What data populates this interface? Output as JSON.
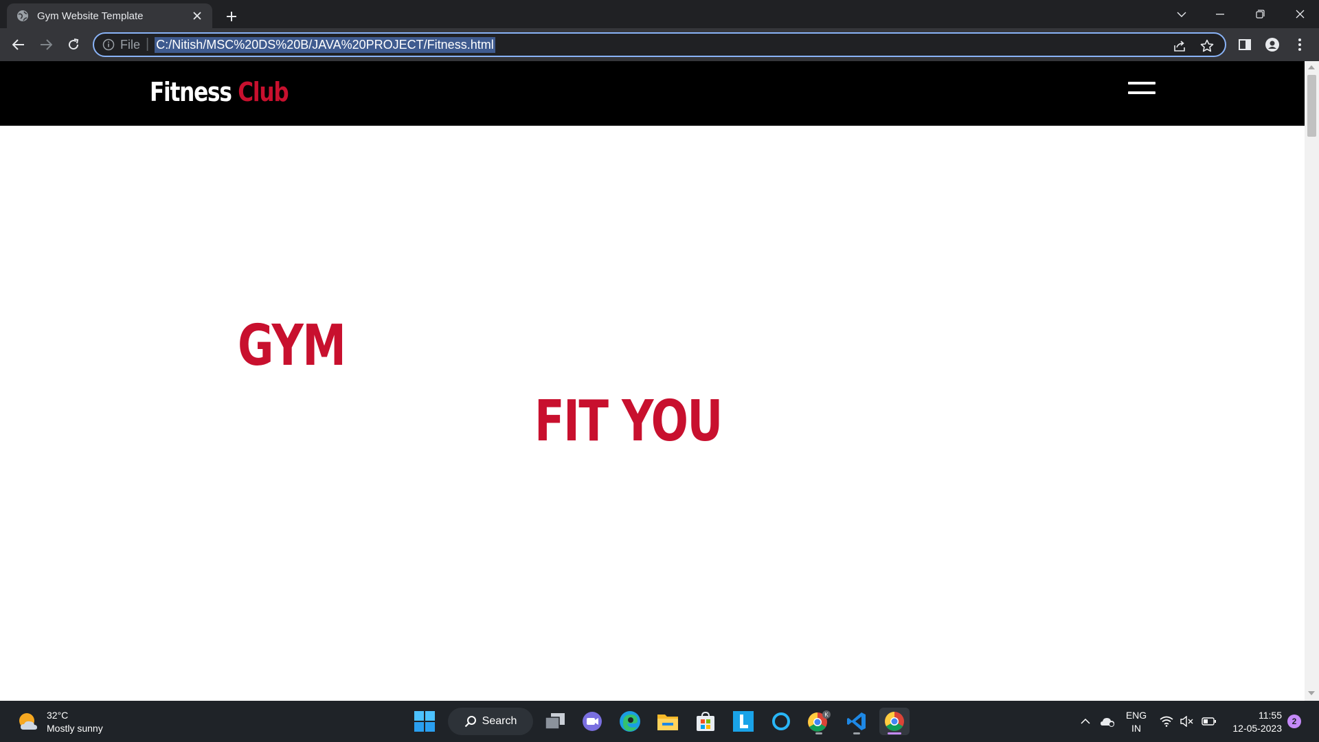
{
  "browser": {
    "tab_title": "Gym Website Template",
    "url_scheme": "File",
    "url": "C:/Nitish/MSC%20DS%20B/JAVA%20PROJECT/Fitness.html"
  },
  "site": {
    "logo_first": "Fitness",
    "logo_second": "Club",
    "hero_word_1": "GYM",
    "hero_word_2": "FIT YOU",
    "accent_color": "#c8102e",
    "header_color": "#000000"
  },
  "taskbar": {
    "weather_temp": "32°C",
    "weather_desc": "Mostly sunny",
    "search_label": "Search",
    "lang_line1": "ENG",
    "lang_line2": "IN",
    "time": "11:55",
    "date": "12-05-2023",
    "notification_count": "2",
    "apps": [
      "task-view",
      "meet",
      "edge",
      "file-explorer",
      "store",
      "l-app",
      "cortana",
      "chrome-profile",
      "vscode",
      "chrome"
    ]
  }
}
